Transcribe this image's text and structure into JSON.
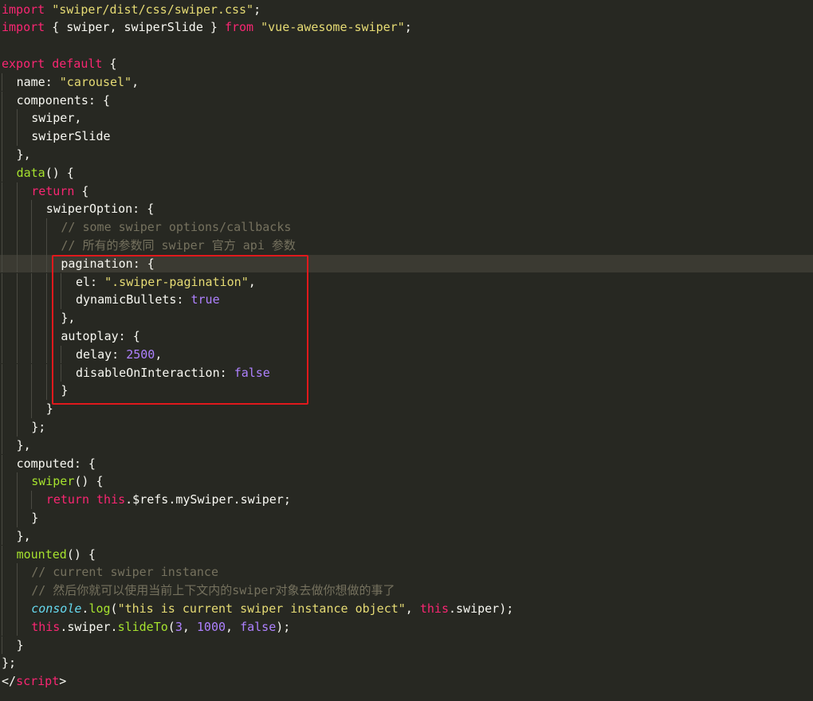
{
  "editor": {
    "current_line_index": 14,
    "lines": [
      {
        "indent": 0,
        "tokens": [
          {
            "t": "import",
            "c": "kw"
          },
          {
            "t": " ",
            "c": "pun"
          },
          {
            "t": "\"swiper/dist/css/swiper.css\"",
            "c": "str"
          },
          {
            "t": ";",
            "c": "pun"
          }
        ]
      },
      {
        "indent": 0,
        "tokens": [
          {
            "t": "import",
            "c": "kw"
          },
          {
            "t": " { swiper, swiperSlide } ",
            "c": "id"
          },
          {
            "t": "from",
            "c": "kw"
          },
          {
            "t": " ",
            "c": "pun"
          },
          {
            "t": "\"vue-awesome-swiper\"",
            "c": "str"
          },
          {
            "t": ";",
            "c": "pun"
          }
        ]
      },
      {
        "indent": 0,
        "tokens": []
      },
      {
        "indent": 0,
        "tokens": [
          {
            "t": "export",
            "c": "kw"
          },
          {
            "t": " ",
            "c": "pun"
          },
          {
            "t": "default",
            "c": "kw"
          },
          {
            "t": " {",
            "c": "pun"
          }
        ]
      },
      {
        "indent": 1,
        "tokens": [
          {
            "t": "name: ",
            "c": "id"
          },
          {
            "t": "\"carousel\"",
            "c": "str"
          },
          {
            "t": ",",
            "c": "pun"
          }
        ]
      },
      {
        "indent": 1,
        "tokens": [
          {
            "t": "components: {",
            "c": "id"
          }
        ]
      },
      {
        "indent": 2,
        "tokens": [
          {
            "t": "swiper,",
            "c": "id"
          }
        ]
      },
      {
        "indent": 2,
        "tokens": [
          {
            "t": "swiperSlide",
            "c": "id"
          }
        ]
      },
      {
        "indent": 1,
        "tokens": [
          {
            "t": "},",
            "c": "pun"
          }
        ]
      },
      {
        "indent": 1,
        "tokens": [
          {
            "t": "data",
            "c": "fn"
          },
          {
            "t": "() {",
            "c": "pun"
          }
        ]
      },
      {
        "indent": 2,
        "tokens": [
          {
            "t": "return",
            "c": "kw"
          },
          {
            "t": " {",
            "c": "pun"
          }
        ]
      },
      {
        "indent": 3,
        "tokens": [
          {
            "t": "swiperOption: {",
            "c": "id"
          }
        ]
      },
      {
        "indent": 4,
        "tokens": [
          {
            "t": "// some swiper options/callbacks",
            "c": "cmt"
          }
        ]
      },
      {
        "indent": 4,
        "tokens": [
          {
            "t": "// 所有的参数同 swiper 官方 api 参数",
            "c": "cmt"
          }
        ]
      },
      {
        "indent": 4,
        "tokens": [
          {
            "t": "pagination: {",
            "c": "id"
          }
        ]
      },
      {
        "indent": 5,
        "tokens": [
          {
            "t": "el: ",
            "c": "id"
          },
          {
            "t": "\".swiper-pagination\"",
            "c": "str"
          },
          {
            "t": ",",
            "c": "pun"
          }
        ]
      },
      {
        "indent": 5,
        "tokens": [
          {
            "t": "dynamicBullets: ",
            "c": "id"
          },
          {
            "t": "true",
            "c": "num"
          }
        ]
      },
      {
        "indent": 4,
        "tokens": [
          {
            "t": "},",
            "c": "pun"
          }
        ]
      },
      {
        "indent": 4,
        "tokens": [
          {
            "t": "autoplay: {",
            "c": "id"
          }
        ]
      },
      {
        "indent": 5,
        "tokens": [
          {
            "t": "delay: ",
            "c": "id"
          },
          {
            "t": "2500",
            "c": "num"
          },
          {
            "t": ",",
            "c": "pun"
          }
        ]
      },
      {
        "indent": 5,
        "tokens": [
          {
            "t": "disableOnInteraction: ",
            "c": "id"
          },
          {
            "t": "false",
            "c": "num"
          }
        ]
      },
      {
        "indent": 4,
        "tokens": [
          {
            "t": "}",
            "c": "pun"
          }
        ]
      },
      {
        "indent": 3,
        "tokens": [
          {
            "t": "}",
            "c": "pun"
          }
        ]
      },
      {
        "indent": 2,
        "tokens": [
          {
            "t": "};",
            "c": "pun"
          }
        ]
      },
      {
        "indent": 1,
        "tokens": [
          {
            "t": "},",
            "c": "pun"
          }
        ]
      },
      {
        "indent": 1,
        "tokens": [
          {
            "t": "computed: {",
            "c": "id"
          }
        ]
      },
      {
        "indent": 2,
        "tokens": [
          {
            "t": "swiper",
            "c": "fn"
          },
          {
            "t": "() {",
            "c": "pun"
          }
        ]
      },
      {
        "indent": 3,
        "tokens": [
          {
            "t": "return",
            "c": "kw"
          },
          {
            "t": " ",
            "c": "pun"
          },
          {
            "t": "this",
            "c": "kw"
          },
          {
            "t": ".$refs.mySwiper.swiper;",
            "c": "id"
          }
        ]
      },
      {
        "indent": 2,
        "tokens": [
          {
            "t": "}",
            "c": "pun"
          }
        ]
      },
      {
        "indent": 1,
        "tokens": [
          {
            "t": "},",
            "c": "pun"
          }
        ]
      },
      {
        "indent": 1,
        "tokens": [
          {
            "t": "mounted",
            "c": "fn"
          },
          {
            "t": "() {",
            "c": "pun"
          }
        ]
      },
      {
        "indent": 2,
        "tokens": [
          {
            "t": "// current swiper instance",
            "c": "cmt"
          }
        ]
      },
      {
        "indent": 2,
        "tokens": [
          {
            "t": "// 然后你就可以使用当前上下文内的swiper对象去做你想做的事了",
            "c": "cmt"
          }
        ]
      },
      {
        "indent": 2,
        "tokens": [
          {
            "t": "console",
            "c": "obj"
          },
          {
            "t": ".",
            "c": "pun"
          },
          {
            "t": "log",
            "c": "fn"
          },
          {
            "t": "(",
            "c": "pun"
          },
          {
            "t": "\"this is current swiper instance object\"",
            "c": "str"
          },
          {
            "t": ", ",
            "c": "pun"
          },
          {
            "t": "this",
            "c": "kw"
          },
          {
            "t": ".swiper);",
            "c": "id"
          }
        ]
      },
      {
        "indent": 2,
        "tokens": [
          {
            "t": "this",
            "c": "kw"
          },
          {
            "t": ".swiper.",
            "c": "id"
          },
          {
            "t": "slideTo",
            "c": "fn"
          },
          {
            "t": "(",
            "c": "pun"
          },
          {
            "t": "3",
            "c": "num"
          },
          {
            "t": ", ",
            "c": "pun"
          },
          {
            "t": "1000",
            "c": "num"
          },
          {
            "t": ", ",
            "c": "pun"
          },
          {
            "t": "false",
            "c": "num"
          },
          {
            "t": ");",
            "c": "pun"
          }
        ]
      },
      {
        "indent": 1,
        "tokens": [
          {
            "t": "}",
            "c": "pun"
          }
        ]
      },
      {
        "indent": 0,
        "tokens": [
          {
            "t": "};",
            "c": "pun"
          }
        ]
      },
      {
        "indent": 0,
        "tokens": [
          {
            "t": "</",
            "c": "pun"
          },
          {
            "t": "script",
            "c": "kw"
          },
          {
            "t": ">",
            "c": "pun"
          }
        ]
      }
    ]
  },
  "colors": {
    "background": "#272822",
    "keyword": "#f92672",
    "string": "#e6db74",
    "function": "#a6e22e",
    "number": "#ae81ff",
    "comment": "#75715e",
    "highlight_box": "#e0191c"
  }
}
